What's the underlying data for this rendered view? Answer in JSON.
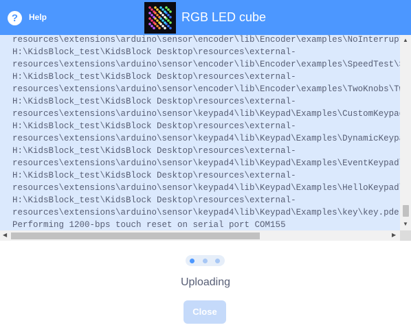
{
  "header": {
    "help_label": "Help",
    "help_icon_glyph": "?",
    "title": "RGB LED cube",
    "thumbnail_icon": "led-cube-thumbnail",
    "background": "#4c97ff"
  },
  "log": {
    "lines": [
      "resources\\extensions\\arduino\\sensor\\encoder\\lib\\Encoder\\examples\\NoInterrupts\\No.",
      "H:\\KidsBlock_test\\KidsBlock Desktop\\resources\\external-",
      "resources\\extensions\\arduino\\sensor\\encoder\\lib\\Encoder\\examples\\SpeedTest\\SpeedT",
      "H:\\KidsBlock_test\\KidsBlock Desktop\\resources\\external-",
      "resources\\extensions\\arduino\\sensor\\encoder\\lib\\Encoder\\examples\\TwoKnobs\\TwoKnob",
      "H:\\KidsBlock_test\\KidsBlock Desktop\\resources\\external-",
      "resources\\extensions\\arduino\\sensor\\keypad4\\lib\\Keypad\\Examples\\CustomKeypad\\Cust",
      "H:\\KidsBlock_test\\KidsBlock Desktop\\resources\\external-",
      "resources\\extensions\\arduino\\sensor\\keypad4\\lib\\Keypad\\Examples\\DynamicKeypad\\Dyn",
      "H:\\KidsBlock_test\\KidsBlock Desktop\\resources\\external-",
      "resources\\extensions\\arduino\\sensor\\keypad4\\lib\\Keypad\\Examples\\EventKeypad\\Event",
      "H:\\KidsBlock_test\\KidsBlock Desktop\\resources\\external-",
      "resources\\extensions\\arduino\\sensor\\keypad4\\lib\\Keypad\\Examples\\HelloKeypad\\Hello",
      "H:\\KidsBlock_test\\KidsBlock Desktop\\resources\\external-",
      "resources\\extensions\\arduino\\sensor\\keypad4\\lib\\Keypad\\Examples\\key\\key.pde",
      "Performing 1200-bps touch reset on serial port COM155"
    ],
    "background": "#dbe9fd"
  },
  "progress": {
    "step_count": 3,
    "active_step": 1,
    "active_color": "#4c97ff",
    "inactive_color": "#a7c7f5"
  },
  "status_text": "Uploading",
  "close_label": "Close"
}
